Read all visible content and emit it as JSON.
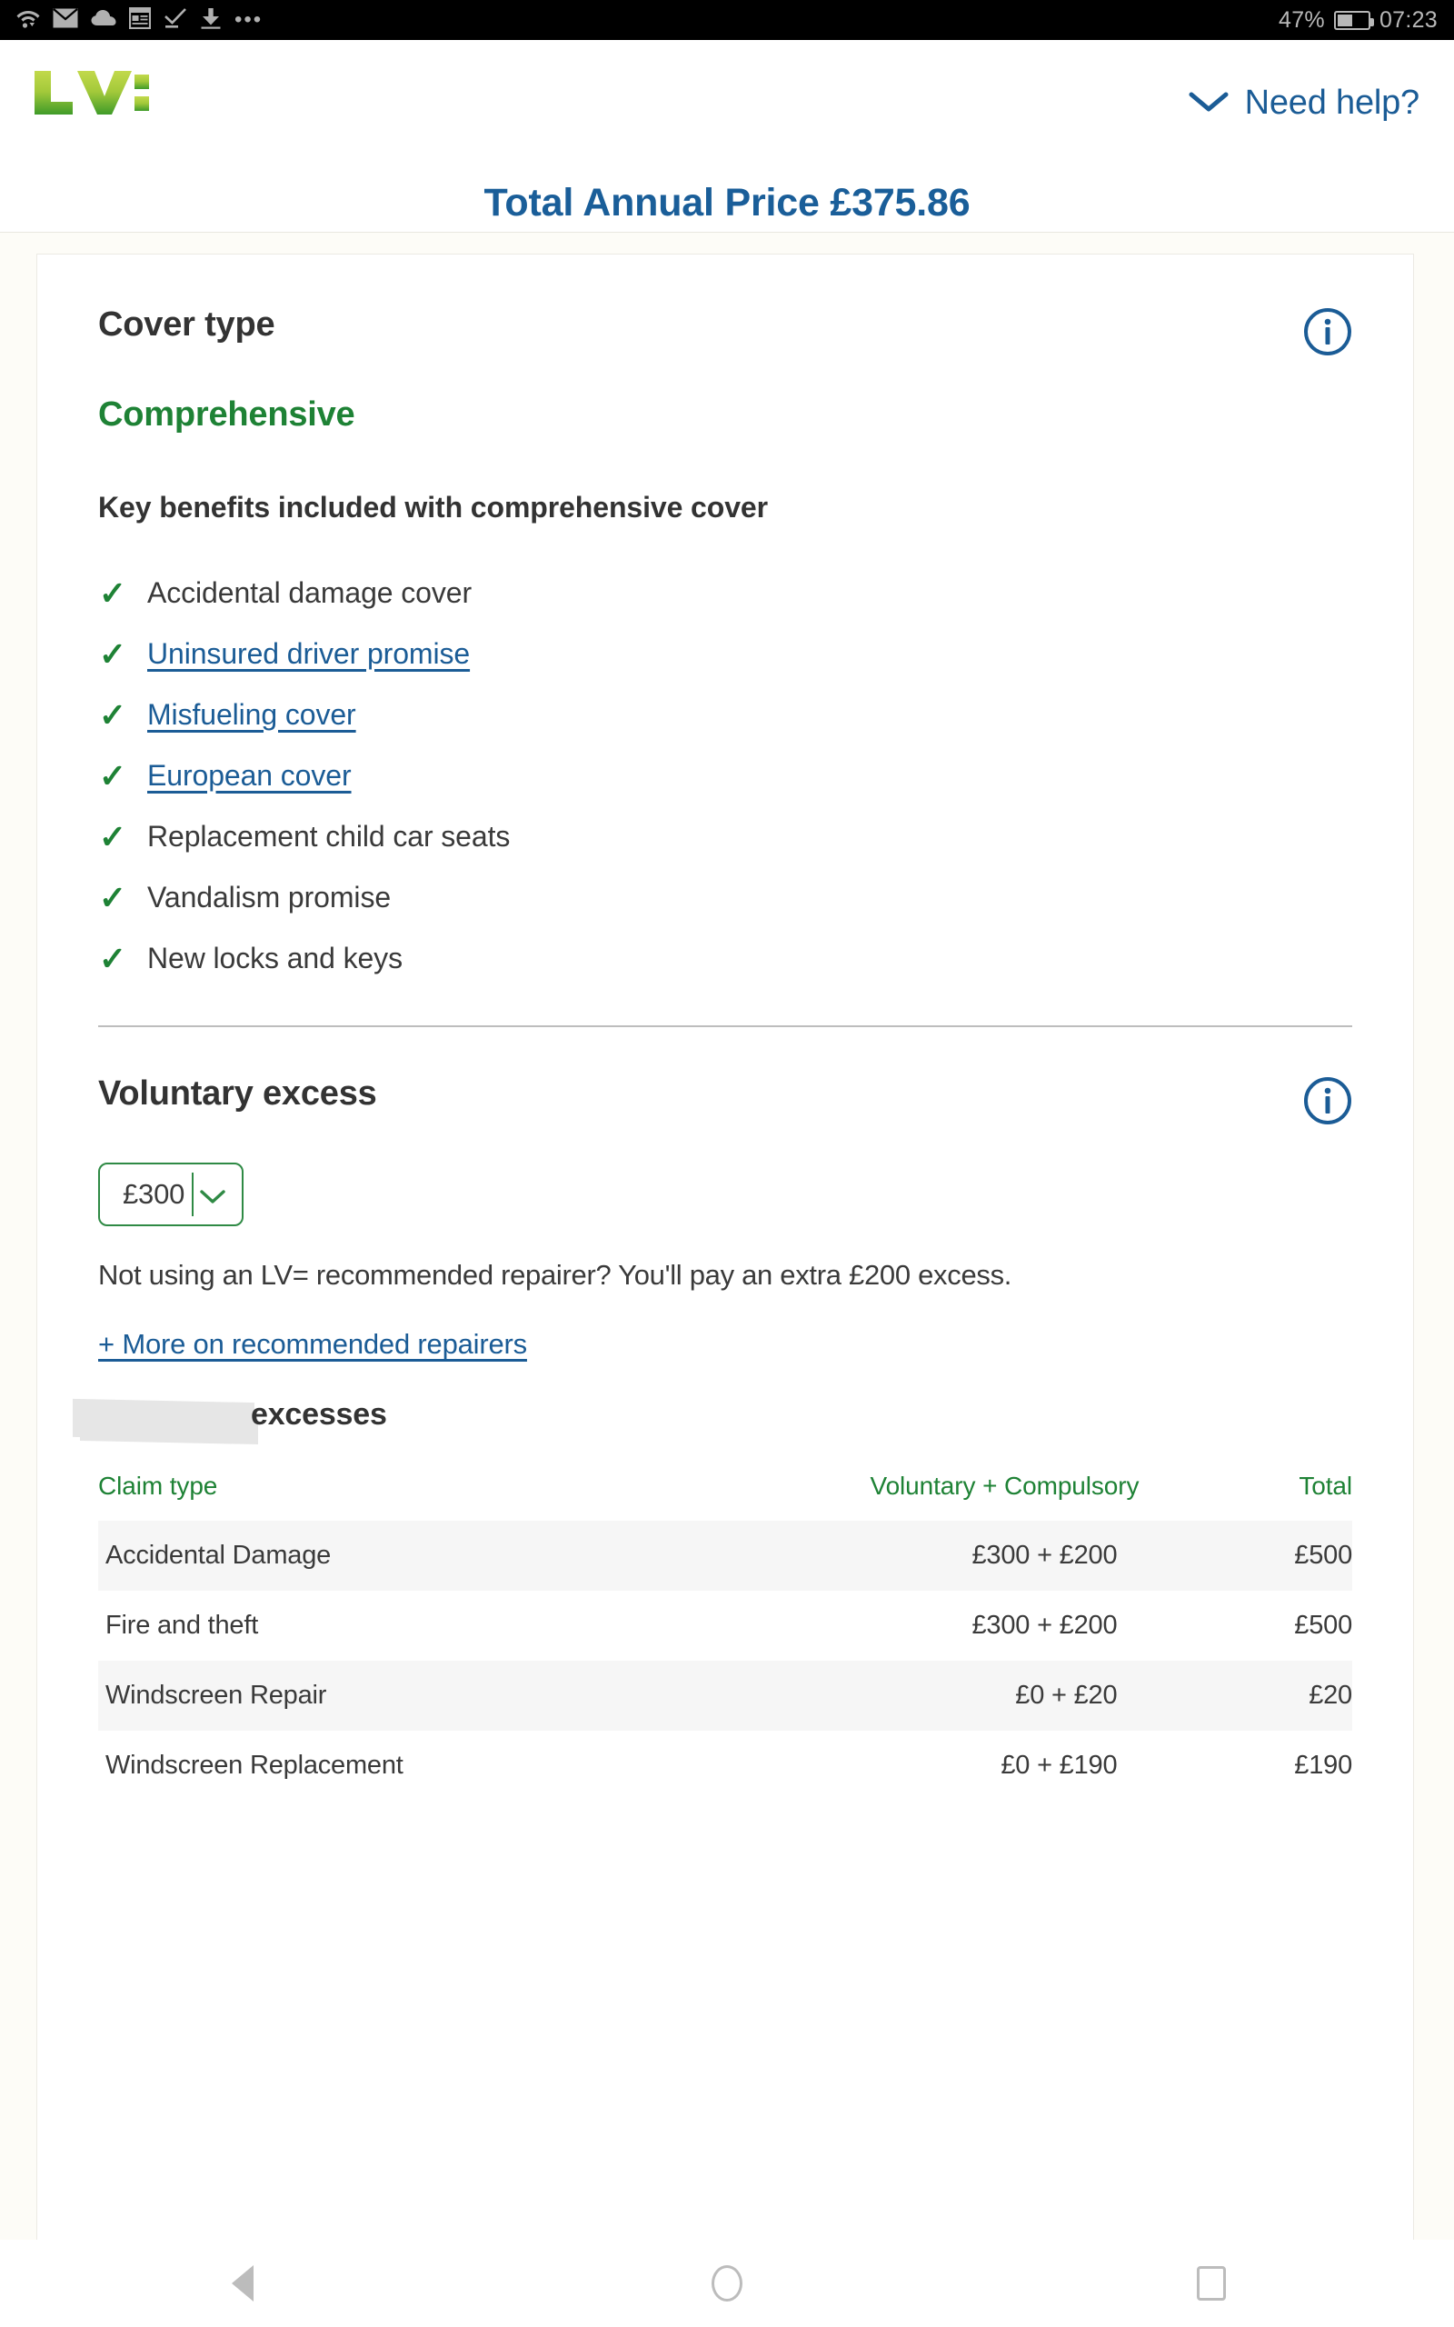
{
  "statusbar": {
    "icons": [
      "wifi-icon",
      "mail-icon",
      "cloud-icon",
      "news-icon",
      "check-icon",
      "download-icon",
      "more-dots-icon"
    ],
    "battery_percent": "47%",
    "time": "07:23"
  },
  "header": {
    "logo_text": "LV=",
    "need_help_label": "Need help?",
    "chevron_icon": "chevron-down-icon",
    "price_title": "Total Annual Price £375.86"
  },
  "cover": {
    "section_label": "Cover type",
    "info_icon": "info-icon",
    "value": "Comprehensive",
    "benefits_title": "Key benefits included with comprehensive cover",
    "benefits": [
      {
        "label": "Accidental damage cover",
        "is_link": false
      },
      {
        "label": "Uninsured driver promise",
        "is_link": true
      },
      {
        "label": "Misfueling cover",
        "is_link": true
      },
      {
        "label": "European cover",
        "is_link": true
      },
      {
        "label": "Replacement child car seats",
        "is_link": false
      },
      {
        "label": "Vandalism promise",
        "is_link": false
      },
      {
        "label": "New locks and keys",
        "is_link": false
      }
    ]
  },
  "voluntary_excess": {
    "section_label": "Voluntary excess",
    "info_icon": "info-icon",
    "selected_value": "£300",
    "dropdown_icon": "chevron-down-icon",
    "note": "Not using an LV= recommended repairer? You'll pay an extra £200 excess.",
    "more_link": "+ More on recommended repairers"
  },
  "excess_table": {
    "heading_redacted": true,
    "heading_visible_word": "excesses",
    "columns": [
      "Claim type",
      "Voluntary + Compulsory",
      "Total"
    ],
    "rows": [
      {
        "claim_type": "Accidental Damage",
        "breakdown": "£300 + £200",
        "total": "£500"
      },
      {
        "claim_type": "Fire and theft",
        "breakdown": "£300 + £200",
        "total": "£500"
      },
      {
        "claim_type": "Windscreen Repair",
        "breakdown": "£0 + £20",
        "total": "£20"
      },
      {
        "claim_type": "Windscreen Replacement",
        "breakdown": "£0 + £190",
        "total": "£190"
      }
    ]
  },
  "navbar": {
    "back_icon": "back-triangle-icon",
    "home_icon": "home-circle-icon",
    "recents_icon": "recents-square-icon"
  },
  "colors": {
    "brand_green": "#1e8235",
    "brand_blue": "#1b5c96",
    "price_blue": "#1a5e99",
    "border_green": "#2f8a45",
    "page_bg": "#fdfcf7"
  }
}
